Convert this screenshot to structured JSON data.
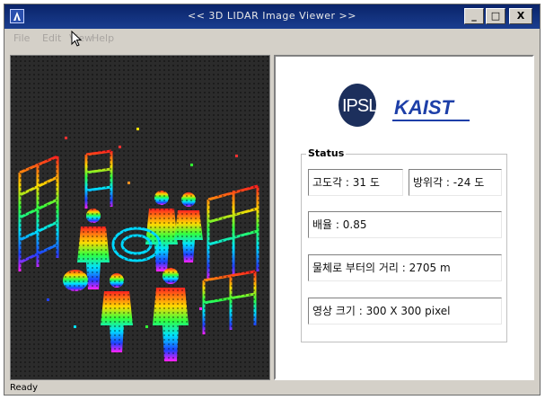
{
  "window": {
    "title": "<< 3D LIDAR Image Viewer >>",
    "buttons": {
      "minimize": "_",
      "maximize": "□",
      "close": "X"
    }
  },
  "menu": [
    "File",
    "Edit",
    "View",
    "Help"
  ],
  "viewer": {
    "content": "3D LIDAR point cloud render"
  },
  "logos": {
    "ipsl": "IPSL",
    "kaist": "KAIST"
  },
  "status": {
    "label": "Status",
    "altitude": "고도각 : 31 도",
    "azimuth": "방위각 : -24 도",
    "ratio": "배율 : 0.85",
    "distance": "물체로 부터의 거리 : 2705 m",
    "image_size": "영상  크기 :  300 X 300 pixel"
  },
  "statusbar": {
    "text": "Ready"
  },
  "colors": {
    "titlebar": "#0a246a",
    "viewer_bg": "#2b2b2b",
    "kaist_blue": "#1d3fa8"
  }
}
